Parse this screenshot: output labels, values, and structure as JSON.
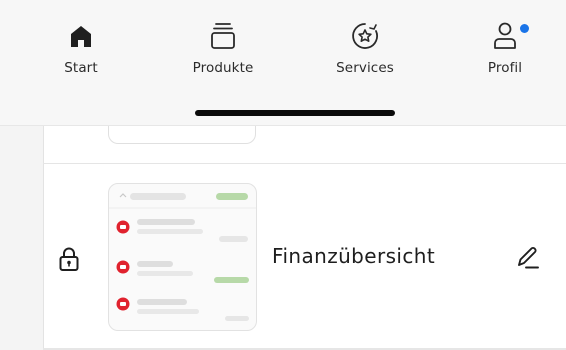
{
  "tabbar": {
    "tabs": [
      {
        "label": "Start",
        "icon": "house-icon",
        "active": true
      },
      {
        "label": "Produkte",
        "icon": "stack-icon"
      },
      {
        "label": "Services",
        "icon": "star-badge-icon"
      },
      {
        "label": "Profil",
        "icon": "person-icon",
        "notification": true
      }
    ],
    "accent": "#1a74e8"
  },
  "card": {
    "title": "Finanzübersicht",
    "locked": true,
    "edit_icon": "pencil-icon",
    "preview": {
      "status_color_red": "#e0222e",
      "status_color_green": "#b7d9a8"
    }
  }
}
